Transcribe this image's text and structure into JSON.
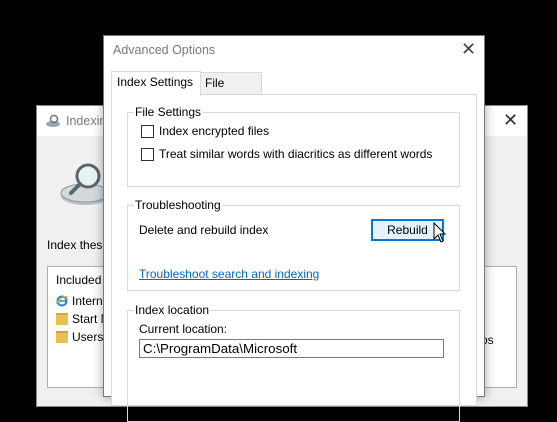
{
  "background_window": {
    "title": "Indexin",
    "index_these_label": "Index these",
    "list": {
      "header": "Included L",
      "items": [
        {
          "label": "Interne",
          "icon": "internet-explorer-icon"
        },
        {
          "label": "Start M",
          "icon": "folder-icon"
        },
        {
          "label": "Users",
          "icon": "folder-icon"
        }
      ],
      "trailing_text": "os"
    }
  },
  "dialog": {
    "title": "Advanced Options",
    "tabs": [
      {
        "label": "Index Settings",
        "active": true
      },
      {
        "label": "File Types",
        "active": false
      }
    ],
    "file_settings": {
      "label": "File Settings",
      "options": [
        {
          "label": "Index encrypted files",
          "checked": false
        },
        {
          "label": "Treat similar words with diacritics as different words",
          "checked": false
        }
      ]
    },
    "troubleshooting": {
      "label": "Troubleshooting",
      "delete_rebuild_label": "Delete and rebuild index",
      "rebuild_button": "Rebuild",
      "troubleshoot_link": "Troubleshoot search and indexing"
    },
    "index_location": {
      "label": "Index location",
      "current_location_label": "Current location:",
      "current_location_value": "C:\\ProgramData\\Microsoft"
    }
  },
  "colors": {
    "accent": "#0078d7",
    "link": "#0066cc",
    "button_bg": "#e5f1fb",
    "window_bg": "#f0f0f0"
  }
}
